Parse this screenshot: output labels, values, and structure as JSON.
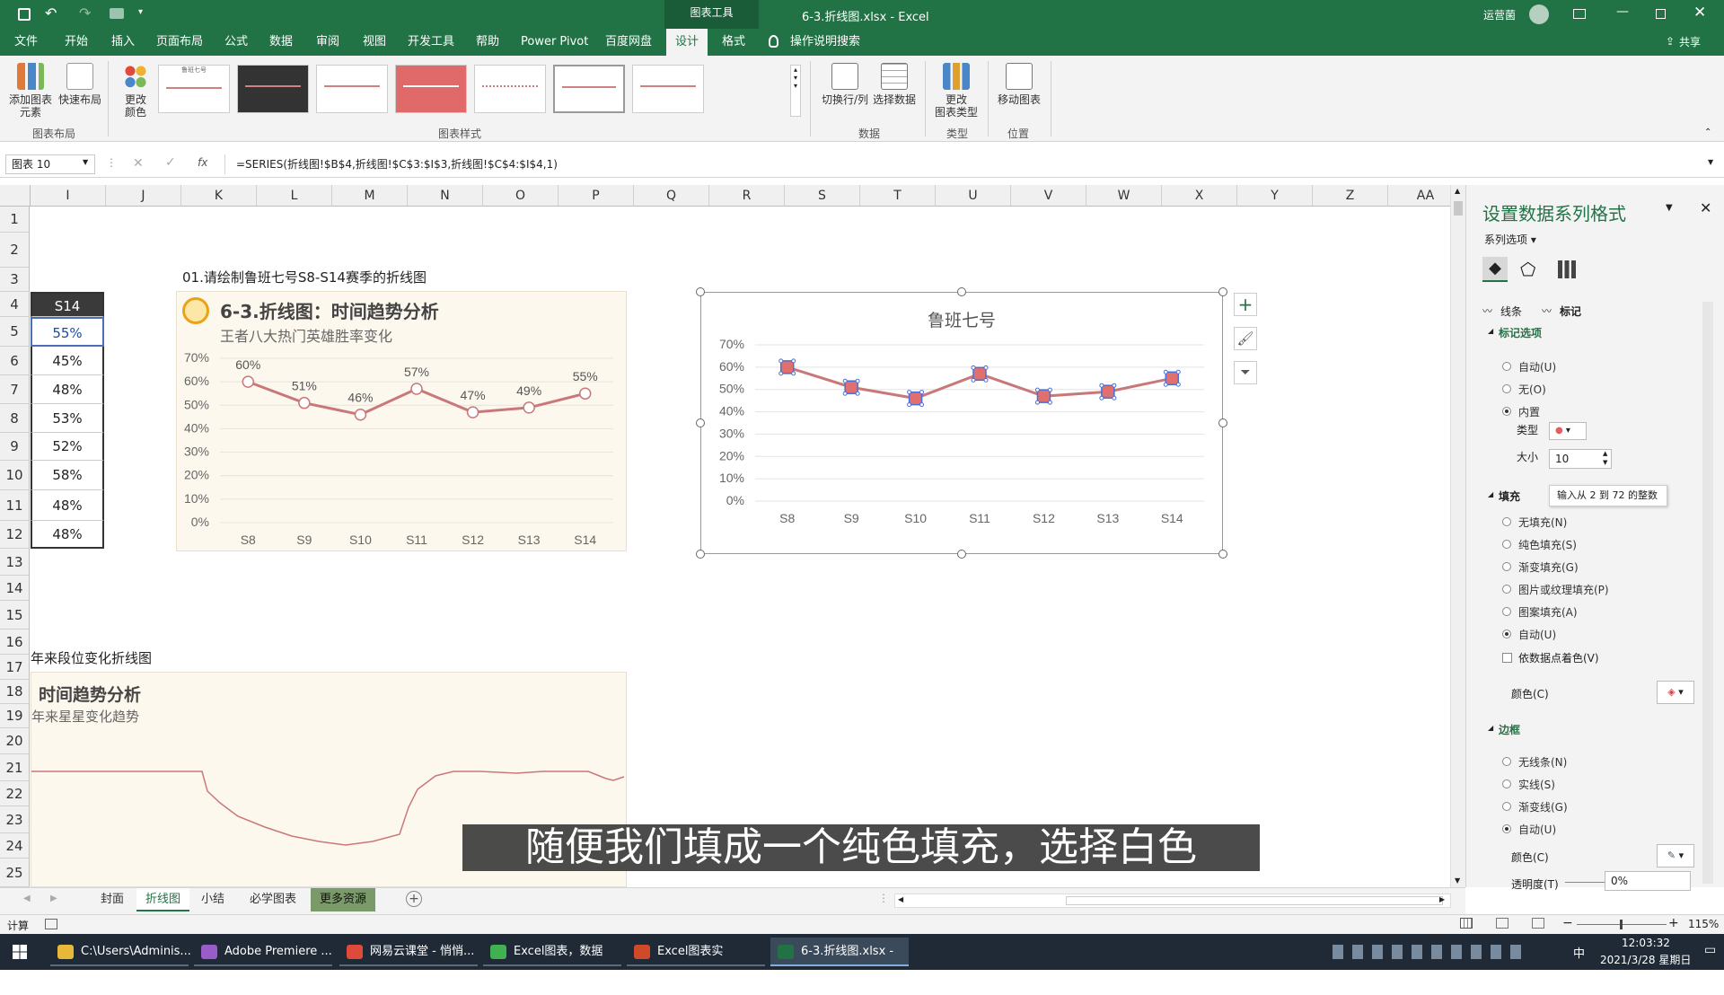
{
  "titlebar": {
    "tools_label": "图表工具",
    "doc_title": "6-3.折线图.xlsx - Excel",
    "user": "运营菌"
  },
  "tabs": [
    "文件",
    "开始",
    "插入",
    "页面布局",
    "公式",
    "数据",
    "审阅",
    "视图",
    "开发工具",
    "帮助",
    "Power Pivot",
    "百度网盘",
    "设计",
    "格式"
  ],
  "tell_me": "操作说明搜索",
  "share": "共享",
  "ribbon": {
    "add_element": "添加图表\n元素",
    "quick_layout": "快速布局",
    "change_colors": "更改\n颜色",
    "group_layout": "图表布局",
    "group_styles": "图表样式",
    "switch_rowcol": "切换行/列",
    "select_data": "选择数据",
    "group_data": "数据",
    "change_type": "更改\n图表类型",
    "group_type": "类型",
    "move_chart": "移动图表",
    "group_location": "位置",
    "style_thumb_title": "鲁班七号"
  },
  "formula": {
    "name_box": "图表 10",
    "content": "=SERIES(折线图!$B$4,折线图!$C$3:$I$3,折线图!$C$4:$I$4,1)"
  },
  "columns": [
    "I",
    "J",
    "K",
    "L",
    "M",
    "N",
    "O",
    "P",
    "Q",
    "R",
    "S",
    "T",
    "U",
    "V",
    "W",
    "X",
    "Y",
    "Z",
    "AA"
  ],
  "rows": [
    "1",
    "2",
    "3",
    "4",
    "5",
    "6",
    "7",
    "8",
    "9",
    "10",
    "11",
    "12",
    "13",
    "14",
    "15",
    "16",
    "17",
    "18",
    "19",
    "20",
    "21",
    "22",
    "23",
    "24",
    "25"
  ],
  "cells": {
    "header": "S14",
    "values": [
      "55%",
      "45%",
      "48%",
      "53%",
      "52%",
      "58%",
      "48%",
      "48%"
    ]
  },
  "sheet_text": {
    "q1": "01.请绘制鲁班七号S8-S14赛季的折线图",
    "q2": "年来段位变化折线图"
  },
  "example_chart": {
    "title": "6-3.折线图：时间趋势分析",
    "subtitle": "王者八大热门英雄胜率变化",
    "logo_color": "#e8a317"
  },
  "example2": {
    "title": "时间趋势分析",
    "subtitle": "年来星星变化趋势"
  },
  "chart_data": [
    {
      "type": "line",
      "title": "",
      "categories": [
        "S8",
        "S9",
        "S10",
        "S11",
        "S12",
        "S13",
        "S14"
      ],
      "series": [
        {
          "values": [
            60,
            51,
            46,
            57,
            47,
            49,
            55
          ]
        }
      ],
      "data_labels": [
        "60%",
        "51%",
        "46%",
        "57%",
        "47%",
        "49%",
        "55%"
      ],
      "y_ticks": [
        "0%",
        "10%",
        "20%",
        "30%",
        "40%",
        "50%",
        "60%",
        "70%"
      ],
      "ylim": [
        0,
        70
      ],
      "grid": true,
      "line_color": "#c9787a"
    },
    {
      "type": "line",
      "title": "鲁班七号",
      "categories": [
        "S8",
        "S9",
        "S10",
        "S11",
        "S12",
        "S13",
        "S14"
      ],
      "series": [
        {
          "values": [
            60,
            51,
            46,
            57,
            47,
            49,
            55
          ]
        }
      ],
      "y_ticks": [
        "0%",
        "10%",
        "20%",
        "30%",
        "40%",
        "50%",
        "60%",
        "70%"
      ],
      "ylim": [
        0,
        70
      ],
      "grid": true,
      "line_color": "#c9787a",
      "marker_color": "#e0706e"
    }
  ],
  "pane": {
    "title": "设置数据系列格式",
    "series_options": "系列选项",
    "tab_line": "线条",
    "tab_marker": "标记",
    "marker_options": "标记选项",
    "marker_radios": [
      "自动(U)",
      "无(O)",
      "内置"
    ],
    "type_label": "类型",
    "size_label": "大小",
    "size_value": "10",
    "tooltip": "输入从 2 到 72 的整数",
    "fill_label": "填充",
    "fill_radios": [
      "无填充(N)",
      "纯色填充(S)",
      "渐变填充(G)",
      "图片或纹理填充(P)",
      "图案填充(A)",
      "自动(U)"
    ],
    "vary_colors": "依数据点着色(V)",
    "color_label": "颜色(C)",
    "border_label": "边框",
    "border_radios": [
      "无线条(N)",
      "实线(S)",
      "渐变线(G)",
      "自动(U)"
    ],
    "color_label2": "颜色(C)",
    "transparency_label": "透明度(T)",
    "transparency_value": "0%"
  },
  "sheets": [
    "封面",
    "折线图",
    "小结",
    "必学图表",
    "更多资源"
  ],
  "status": {
    "ready": "计算",
    "zoom": "115%"
  },
  "taskbar": [
    {
      "label": "C:\\Users\\Adminis...",
      "color": "#e8b83a"
    },
    {
      "label": "Adobe Premiere ...",
      "color": "#9a5cc8"
    },
    {
      "label": "网易云课堂 - 悄悄...",
      "color": "#e04a3a"
    },
    {
      "label": "Excel图表，数据可...",
      "color": "#40b050"
    },
    {
      "label": "Excel图表实战.ppt...",
      "color": "#d04a2a"
    },
    {
      "label": "6-3.折线图.xlsx - E...",
      "color": "#217346"
    }
  ],
  "clock": {
    "time": "12:03:32",
    "date": "2021/3/28 星期日"
  },
  "ime": "中",
  "subtitle": "随便我们填成一个纯色填充，选择白色"
}
